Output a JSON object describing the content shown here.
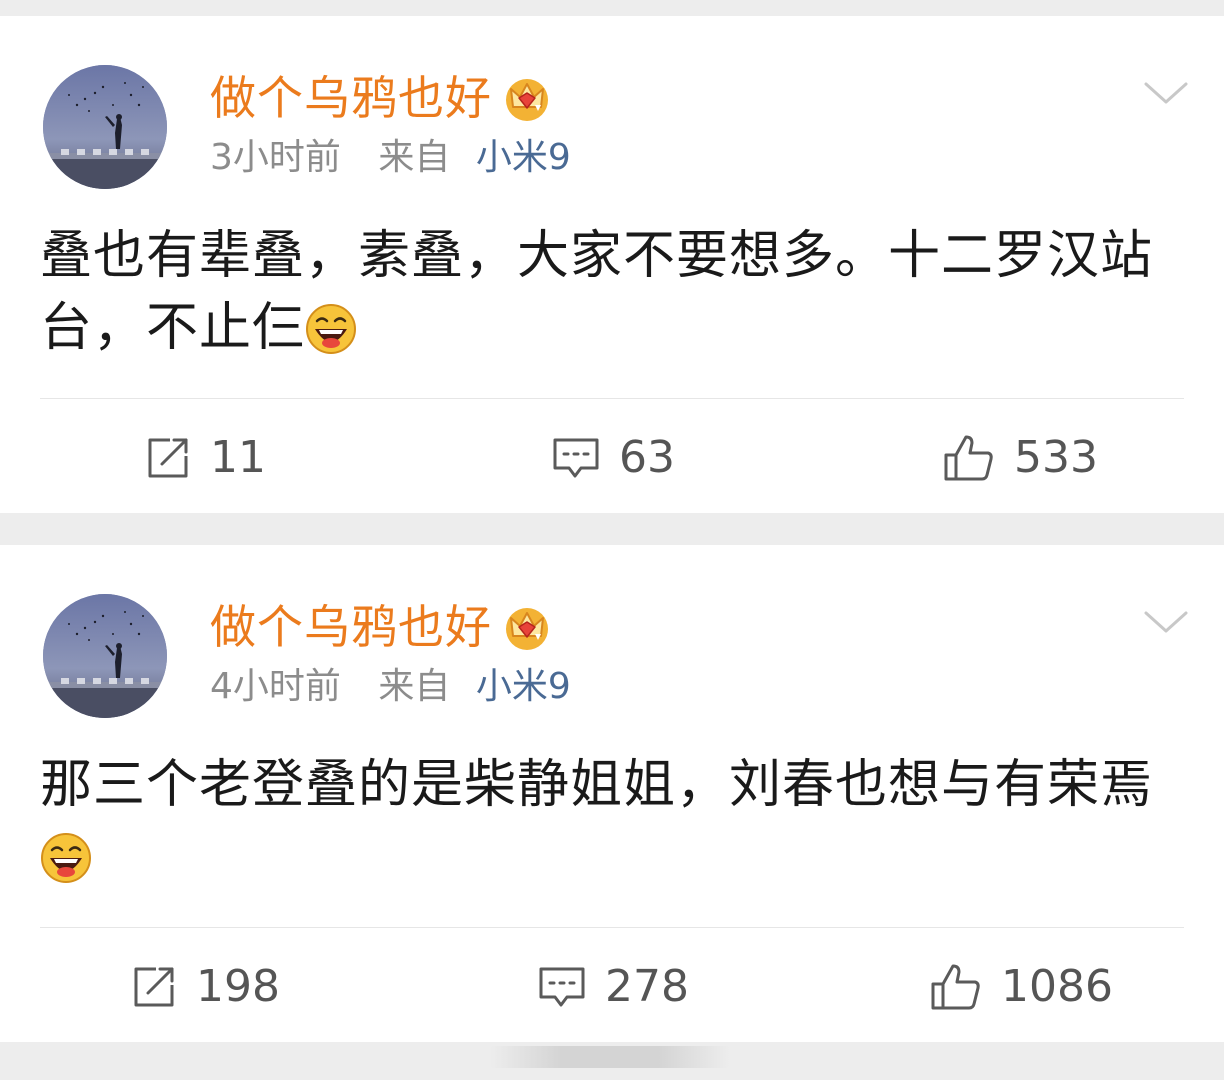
{
  "posts": [
    {
      "username": "做个乌鸦也好",
      "time": "3小时前",
      "from_label": "来自",
      "device": "小米9",
      "text": "叠也有辈叠，素叠，大家不要想多。十二罗汉站台，不止仨",
      "reposts": "11",
      "comments": "63",
      "likes": "533"
    },
    {
      "username": "做个乌鸦也好",
      "time": "4小时前",
      "from_label": "来自",
      "device": "小米9",
      "text": "那三个老登叠的是柴静姐姐，刘春也想与有荣焉",
      "reposts": "198",
      "comments": "278",
      "likes": "1086"
    }
  ],
  "icons": {
    "verified_badge": "crown-icon",
    "menu": "chevron-down-icon",
    "emoji": "laugh-emoji-icon",
    "repost": "repost-icon",
    "comment": "comment-icon",
    "like": "thumbs-up-icon"
  },
  "colors": {
    "username": "#eb7b1d",
    "device": "#4a6a94",
    "meta": "#8c8c8c",
    "text": "#1a1a1a",
    "background": "#ededed"
  }
}
